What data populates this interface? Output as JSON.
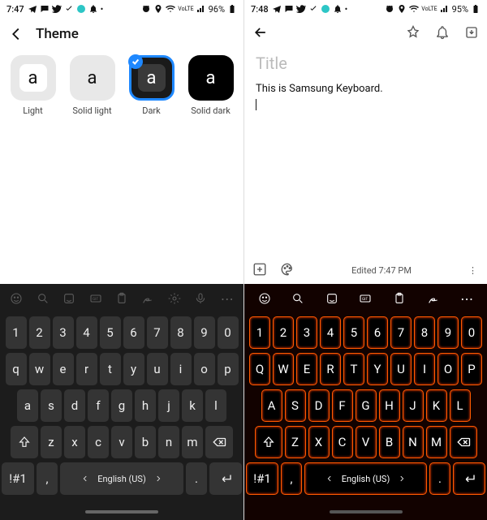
{
  "left": {
    "status": {
      "time": "7:47",
      "battery": "96%",
      "net_label": "VoLTE"
    },
    "title": "Theme",
    "themes": [
      {
        "glyph": "a",
        "label": "Light"
      },
      {
        "glyph": "a",
        "label": "Solid light"
      },
      {
        "glyph": "a",
        "label": "Dark",
        "selected": true
      },
      {
        "glyph": "a",
        "label": "Solid dark"
      }
    ],
    "keyboard": {
      "row_num": [
        "1",
        "2",
        "3",
        "4",
        "5",
        "6",
        "7",
        "8",
        "9",
        "0"
      ],
      "row1": [
        "q",
        "w",
        "e",
        "r",
        "t",
        "y",
        "u",
        "i",
        "o",
        "p"
      ],
      "row2": [
        "a",
        "s",
        "d",
        "f",
        "g",
        "h",
        "j",
        "k",
        "l"
      ],
      "row3": [
        "z",
        "x",
        "c",
        "v",
        "b",
        "n",
        "m"
      ],
      "symnum": "!#1",
      "comma": ",",
      "space_label": "English (US)",
      "period": "."
    }
  },
  "right": {
    "status": {
      "time": "7:48",
      "battery": "95%",
      "net_label": "VoLTE"
    },
    "note": {
      "title_placeholder": "Title",
      "body": "This is Samsung Keyboard.",
      "footer_time": "Edited 7:47 PM"
    },
    "keyboard": {
      "row_num": [
        "1",
        "2",
        "3",
        "4",
        "5",
        "6",
        "7",
        "8",
        "9",
        "0"
      ],
      "row1": [
        "Q",
        "W",
        "E",
        "R",
        "T",
        "Y",
        "U",
        "I",
        "O",
        "P"
      ],
      "row2": [
        "A",
        "S",
        "D",
        "F",
        "G",
        "H",
        "J",
        "K",
        "L"
      ],
      "row3": [
        "Z",
        "X",
        "C",
        "V",
        "B",
        "N",
        "M"
      ],
      "symnum": "!#1",
      "comma": ",",
      "space_label": "English (US)",
      "period": "."
    }
  }
}
